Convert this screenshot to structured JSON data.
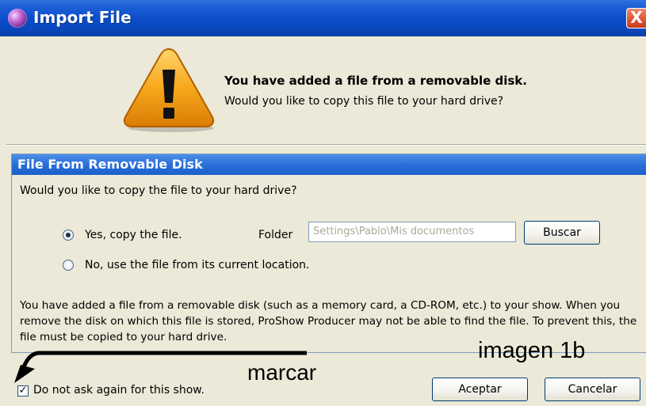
{
  "window": {
    "title": "Import File",
    "close_glyph": "X"
  },
  "warning": {
    "icon": "warning-triangle-icon",
    "title": "You have added a file from a removable disk.",
    "subtitle": "Would you like to copy this file to your hard drive?"
  },
  "group": {
    "header": "File From Removable Disk",
    "question": "Would you like to copy the file to your hard drive?",
    "option_copy": "Yes, copy the file.",
    "option_copy_selected": true,
    "folder_label": "Folder",
    "folder_value": "Settings\\Pablo\\Mis documentos",
    "browse_label": "Buscar",
    "option_keep": "No, use the file from its current location.",
    "info_text": "You have added a file from a removable disk (such as a memory card, a CD-ROM, etc.) to your show. When you remove the disk on which this file is stored, ProShow Producer may not be able to find the file. To prevent this, the file must be copied to your hard drive."
  },
  "footer": {
    "dont_ask_label": "Do not ask again for this show.",
    "dont_ask_checked": true,
    "check_glyph": "✓",
    "ok_label": "Aceptar",
    "cancel_label": "Cancelar"
  },
  "annotations": {
    "marcar": "marcar",
    "imagen": "imagen 1b"
  },
  "colors": {
    "titlebar": "#0a4cc8",
    "group_header": "#2a6fd9",
    "dialog_bg": "#ece9d8",
    "close_button": "#e45d3f",
    "warning_orange": "#f5a11a"
  }
}
